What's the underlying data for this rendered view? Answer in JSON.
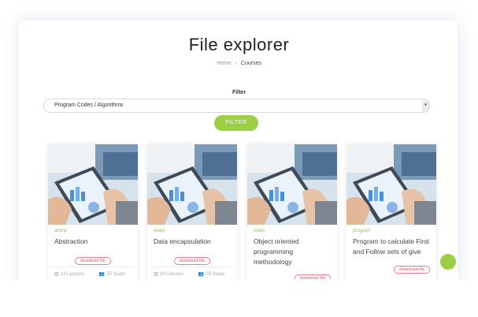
{
  "header": {
    "title": "File explorer"
  },
  "breadcrumb": {
    "home": "Home",
    "separator": "›",
    "current": "Courses"
  },
  "filter": {
    "label": "Filter",
    "selected": "Program Codes / Algorithms",
    "button_label": "FILTER"
  },
  "cards": [
    {
      "category": "amine",
      "title": "Abstraction",
      "download_label": "download file",
      "lessons": "14 Lessons",
      "seats": "25 Seats"
    },
    {
      "category": "video",
      "title": "Data encapsulation",
      "download_label": "download file",
      "lessons": "14 Lessons",
      "seats": "25 Seats"
    },
    {
      "category": "video",
      "title": "Object oriented programming methodology",
      "download_label": "download file",
      "lessons": "",
      "seats": ""
    },
    {
      "category": "program",
      "title": "Program to calculate First and Follow sets of give",
      "download_label": "download file",
      "lessons": "",
      "seats": ""
    }
  ],
  "colors": {
    "accent": "#9ccf46",
    "download": "#ef4f5a"
  }
}
